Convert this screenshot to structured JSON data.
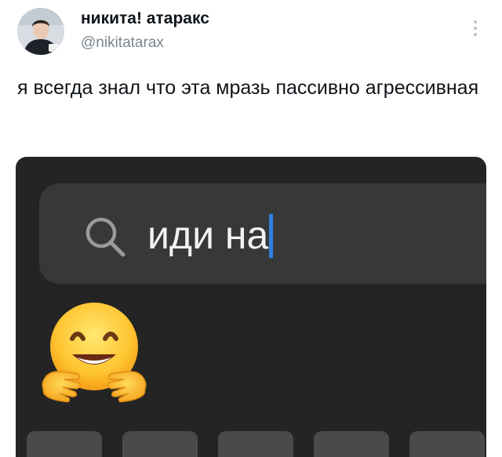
{
  "author": {
    "display_name": "никита! атаракс",
    "handle": "@nikitatarax",
    "avatar": "avatar-photo"
  },
  "tweet": {
    "text": "я всегда знал что эта мразь пассивно агрессивная",
    "more_icon": "more-vertical-icon"
  },
  "media": {
    "search_query": "иди на",
    "search_icon": "search-icon",
    "emoji": "hugging-face-emoji",
    "colors": {
      "background": "#242424",
      "field": "#383838",
      "caret": "#2f7fe0",
      "text": "#f2f2f2"
    }
  }
}
